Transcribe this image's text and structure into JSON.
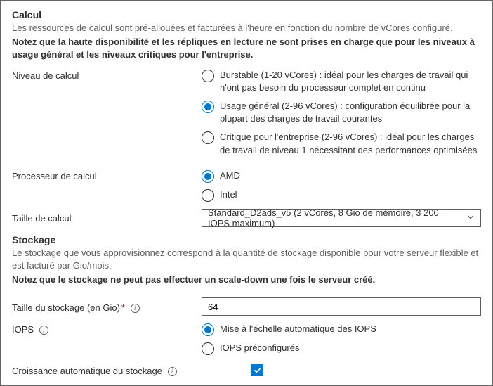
{
  "compute": {
    "heading": "Calcul",
    "desc": "Les ressources de calcul sont pré-allouées et facturées à l'heure en fonction du nombre de vCores configuré.",
    "note": "Notez que la haute disponibilité et les répliques en lecture ne sont prises en charge que pour les niveaux à usage général et les niveaux critiques pour l'entreprise.",
    "tier_label": "Niveau de calcul",
    "tiers": {
      "burstable": "Burstable (1-20 vCores) : idéal pour les charges de travail qui n'ont pas besoin du processeur complet en continu",
      "general": "Usage général (2-96 vCores) : configuration équilibrée pour la plupart des charges de travail courantes",
      "business": "Critique pour l'entreprise (2-96 vCores) : idéal pour les charges de travail de niveau 1 nécessitant des performances optimisées"
    },
    "processor_label": "Processeur de calcul",
    "processors": {
      "amd": "AMD",
      "intel": "Intel"
    },
    "size_label": "Taille de calcul",
    "size_value": "Standard_D2ads_v5 (2 vCores, 8 Gio de mémoire, 3 200 IOPS maximum)"
  },
  "storage": {
    "heading": "Stockage",
    "desc": "Le stockage que vous approvisionnez correspond à la quantité de stockage disponible pour votre serveur flexible et est facturé par Gio/mois.",
    "note": "Notez que le stockage ne peut pas effectuer un scale-down une fois le serveur créé.",
    "size_label": "Taille du stockage (en Gio)",
    "size_value": "64",
    "iops_label": "IOPS",
    "iops_options": {
      "auto": "Mise à l'échelle automatique des IOPS",
      "pre": "IOPS préconfigurés"
    },
    "autogrow_label": "Croissance automatique du stockage"
  }
}
